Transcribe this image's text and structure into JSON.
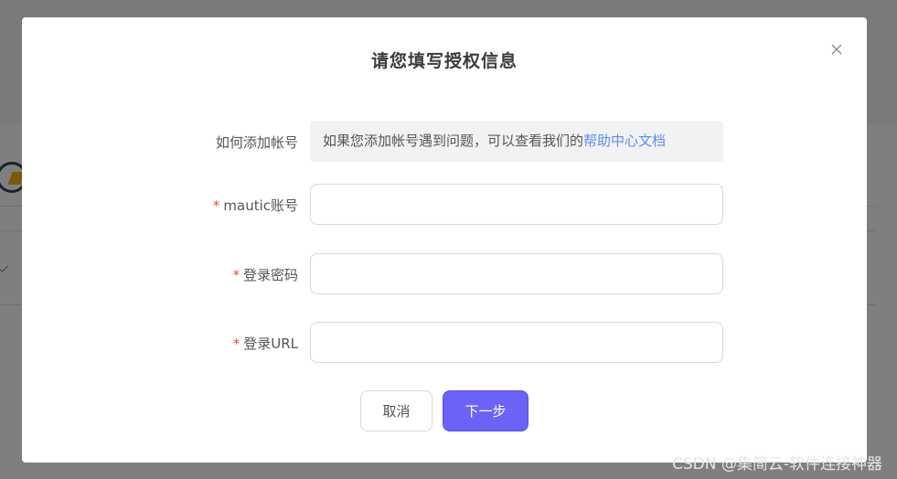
{
  "dialog": {
    "title": "请您填写授权信息",
    "close_icon": "close-icon"
  },
  "form": {
    "how_to_label": "如何添加帐号",
    "how_to_tip_text": "如果您添加帐号遇到问题，可以查看我们的",
    "how_to_tip_link": "帮助中心文档",
    "required_mark": "*",
    "account_label": "mautic账号",
    "account_value": "",
    "password_label": "登录密码",
    "password_value": "",
    "url_label": "登录URL",
    "url_value": ""
  },
  "buttons": {
    "cancel": "取消",
    "next": "下一步"
  },
  "watermark": "CSDN @集简云-软件连接神器",
  "colors": {
    "primary": "#6b63f5",
    "link": "#5b8ff0",
    "required": "#e74c3c"
  }
}
